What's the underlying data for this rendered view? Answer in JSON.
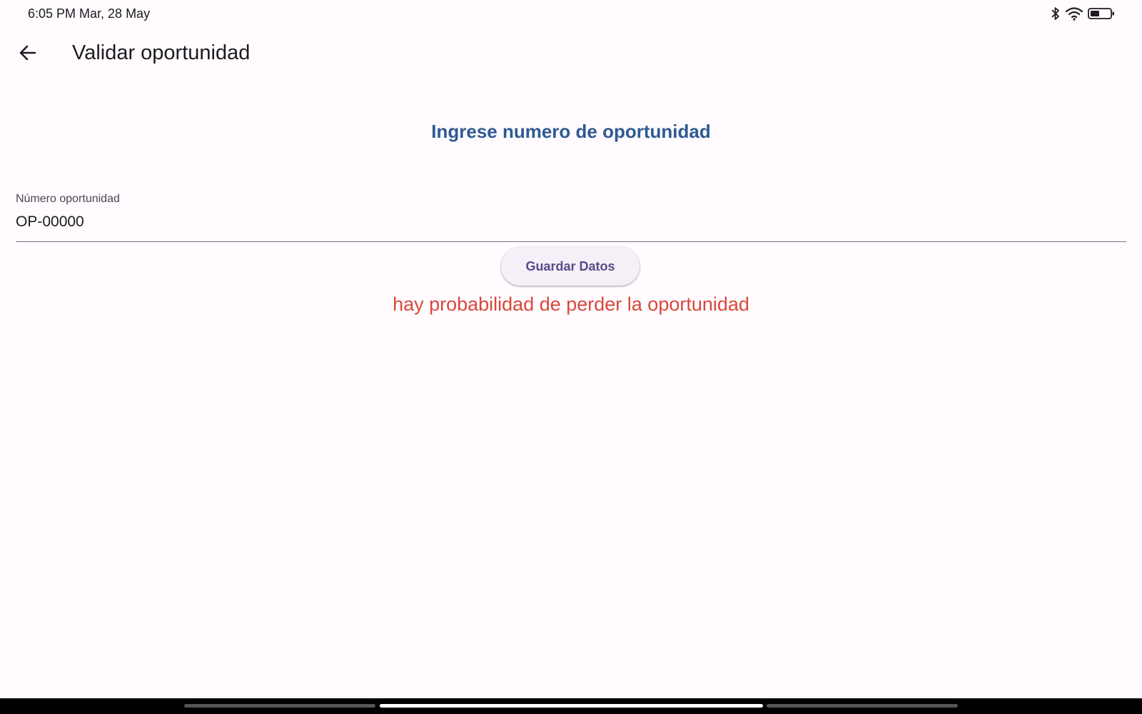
{
  "status_bar": {
    "time": "6:05 PM Mar, 28 May",
    "icons": [
      "bluetooth-icon",
      "wifi-icon",
      "battery-icon"
    ]
  },
  "app_bar": {
    "back_icon": "arrow-back-icon",
    "title": "Validar oportunidad"
  },
  "form": {
    "heading": "Ingrese numero de oportunidad",
    "field_label": "Número oportunidad",
    "field_value": "OP-00000",
    "button_label": "Guardar Datos",
    "warning": "hay probabilidad de perder la oportunidad"
  },
  "colors": {
    "heading": "#2f5a92",
    "warning": "#d9483b",
    "button_text": "#5b4a8b",
    "background": "#fffbfe"
  }
}
